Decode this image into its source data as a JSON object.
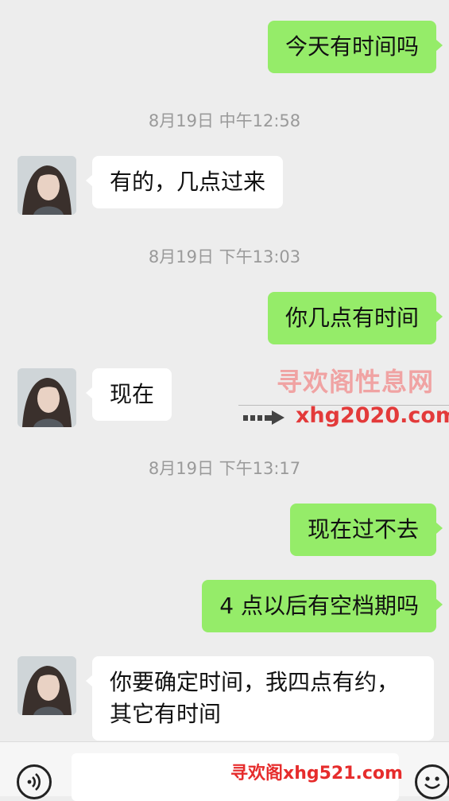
{
  "messages": [
    {
      "text": "今天有时间吗"
    },
    {
      "time": "8月19日 中午12:58"
    },
    {
      "text": "有的，几点过来"
    },
    {
      "time": "8月19日 下午13:03"
    },
    {
      "text": "你几点有时间"
    },
    {
      "text": "现在"
    },
    {
      "time": "8月19日 下午13:17"
    },
    {
      "text": "现在过不去"
    },
    {
      "text": "4 点以后有空档期吗"
    },
    {
      "text": "你要确定时间，我四点有约，其它有时间"
    }
  ],
  "watermark": {
    "title": "寻欢阁性息网",
    "url": "xhg2020.com",
    "bottom": "寻欢阁xhg521.com"
  },
  "colors": {
    "outgoing_bubble": "#95ec69",
    "incoming_bubble": "#ffffff",
    "background": "#ededed"
  },
  "icons": {
    "voice": "voice-icon",
    "emoji": "emoji-icon"
  }
}
